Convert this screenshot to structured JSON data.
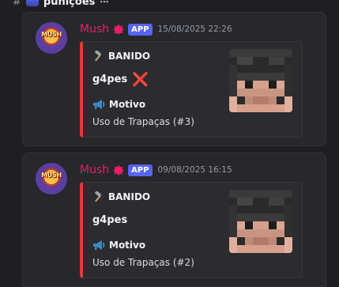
{
  "channel": {
    "hash": "#",
    "name": "punições",
    "extra": "⋯"
  },
  "messages": [
    {
      "author": "Mush",
      "avatar_text": "MUSH",
      "badge": "APP",
      "timestamp": "15/08/2025 22:26",
      "embed": {
        "color": "#e53935",
        "title": "BANIDO",
        "player": "g4pes",
        "player_mark": "❌",
        "field_name": "Motivo",
        "field_value": "Uso de Trapaças (#3)"
      }
    },
    {
      "author": "Mush",
      "avatar_text": "MUSH",
      "badge": "APP",
      "timestamp": "09/08/2025 16:15",
      "embed": {
        "color": "#e53935",
        "title": "BANIDO",
        "player": "g4pes",
        "player_mark": "",
        "field_name": "Motivo",
        "field_value": "Uso de Trapaças (#2)"
      }
    }
  ],
  "icons": {
    "title_icon": "hammer-icon",
    "field_icon": "megaphone-icon",
    "author_icon": "flower-icon",
    "player_mark_icon": "x-icon"
  },
  "colors": {
    "username": "#e91e63",
    "app_badge": "#5865f2",
    "embed_bar": "#e53935"
  }
}
